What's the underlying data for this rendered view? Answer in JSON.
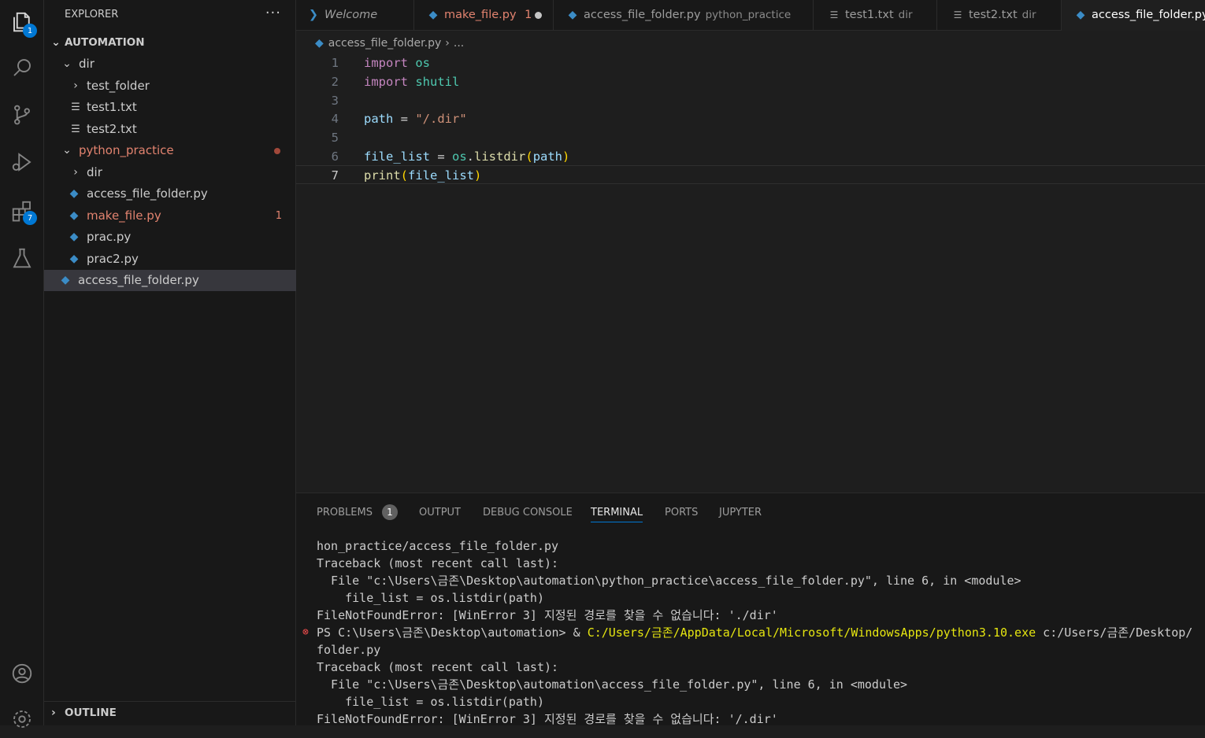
{
  "explorer": {
    "title": "EXPLORER",
    "more": "···",
    "section": "AUTOMATION",
    "outline": "OUTLINE",
    "tree": [
      {
        "label": "dir",
        "kind": "folder-open",
        "depth": 1
      },
      {
        "label": "test_folder",
        "kind": "folder",
        "depth": 2
      },
      {
        "label": "test1.txt",
        "kind": "txt",
        "depth": 2
      },
      {
        "label": "test2.txt",
        "kind": "txt",
        "depth": 2
      },
      {
        "label": "python_practice",
        "kind": "folder-open",
        "depth": 1,
        "modified": true
      },
      {
        "label": "dir",
        "kind": "folder",
        "depth": 2
      },
      {
        "label": "access_file_folder.py",
        "kind": "py",
        "depth": 2
      },
      {
        "label": "make_file.py",
        "kind": "py",
        "depth": 2,
        "modified": true,
        "count": "1"
      },
      {
        "label": "prac.py",
        "kind": "py",
        "depth": 2
      },
      {
        "label": "prac2.py",
        "kind": "py",
        "depth": 2
      },
      {
        "label": "access_file_folder.py",
        "kind": "py",
        "depth": 1,
        "selected": true
      }
    ]
  },
  "activity": {
    "explorer_badge": "1",
    "extensions_badge": "7"
  },
  "tabs": [
    {
      "label": "Welcome",
      "desc": "",
      "kind": "vscode",
      "italic": true
    },
    {
      "label": "make_file.py",
      "desc": "",
      "kind": "py",
      "modified_mark": "1",
      "dirty": true
    },
    {
      "label": "access_file_folder.py",
      "desc": "python_practice",
      "kind": "py"
    },
    {
      "label": "test1.txt",
      "desc": "dir",
      "kind": "txt"
    },
    {
      "label": "test2.txt",
      "desc": "dir",
      "kind": "txt"
    },
    {
      "label": "access_file_folder.py",
      "desc": "",
      "kind": "py",
      "active": true
    }
  ],
  "breadcrumb": {
    "file": "access_file_folder.py",
    "rest": "..."
  },
  "code": {
    "numbers": [
      "1",
      "2",
      "3",
      "4",
      "5",
      "6",
      "7"
    ],
    "current_line": 7,
    "l1": {
      "kw": "import",
      "mod": "os"
    },
    "l2": {
      "kw": "import",
      "mod": "shutil"
    },
    "l4": {
      "var": "path",
      "op": " = ",
      "str": "\"/.dir\""
    },
    "l6": {
      "var": "file_list",
      "op": " = ",
      "mod": "os",
      "dot": ".",
      "fn": "listdir",
      "p1": "(",
      "arg": "path",
      "p2": ")"
    },
    "l7": {
      "fn": "print",
      "p1": "(",
      "arg": "file_list",
      "p2": ")"
    }
  },
  "panel": {
    "tabs": [
      "PROBLEMS",
      "OUTPUT",
      "DEBUG CONSOLE",
      "TERMINAL",
      "PORTS",
      "JUPYTER"
    ],
    "problems_count": "1",
    "active": "TERMINAL",
    "terminal": [
      "hon_practice/access_file_folder.py",
      "Traceback (most recent call last):",
      "  File \"c:\\Users\\금존\\Desktop\\automation\\python_practice\\access_file_folder.py\", line 6, in <module>",
      "    file_list = os.listdir(path)",
      "FileNotFoundError: [WinError 3] 지정된 경로를 찾을 수 없습니다: './dir'"
    ],
    "prompt": {
      "ps": "PS C:\\Users\\금존\\Desktop\\automation> & ",
      "exe": "C:/Users/금존/AppData/Local/Microsoft/WindowsApps/python3.10.exe",
      "arg": " c:/Users/금존/Desktop/"
    },
    "terminal2": [
      "folder.py",
      "Traceback (most recent call last):",
      "  File \"c:\\Users\\금존\\Desktop\\automation\\access_file_folder.py\", line 6, in <module>",
      "    file_list = os.listdir(path)",
      "FileNotFoundError: [WinError 3] 지정된 경로를 찾을 수 없습니다: '/.dir'"
    ]
  }
}
